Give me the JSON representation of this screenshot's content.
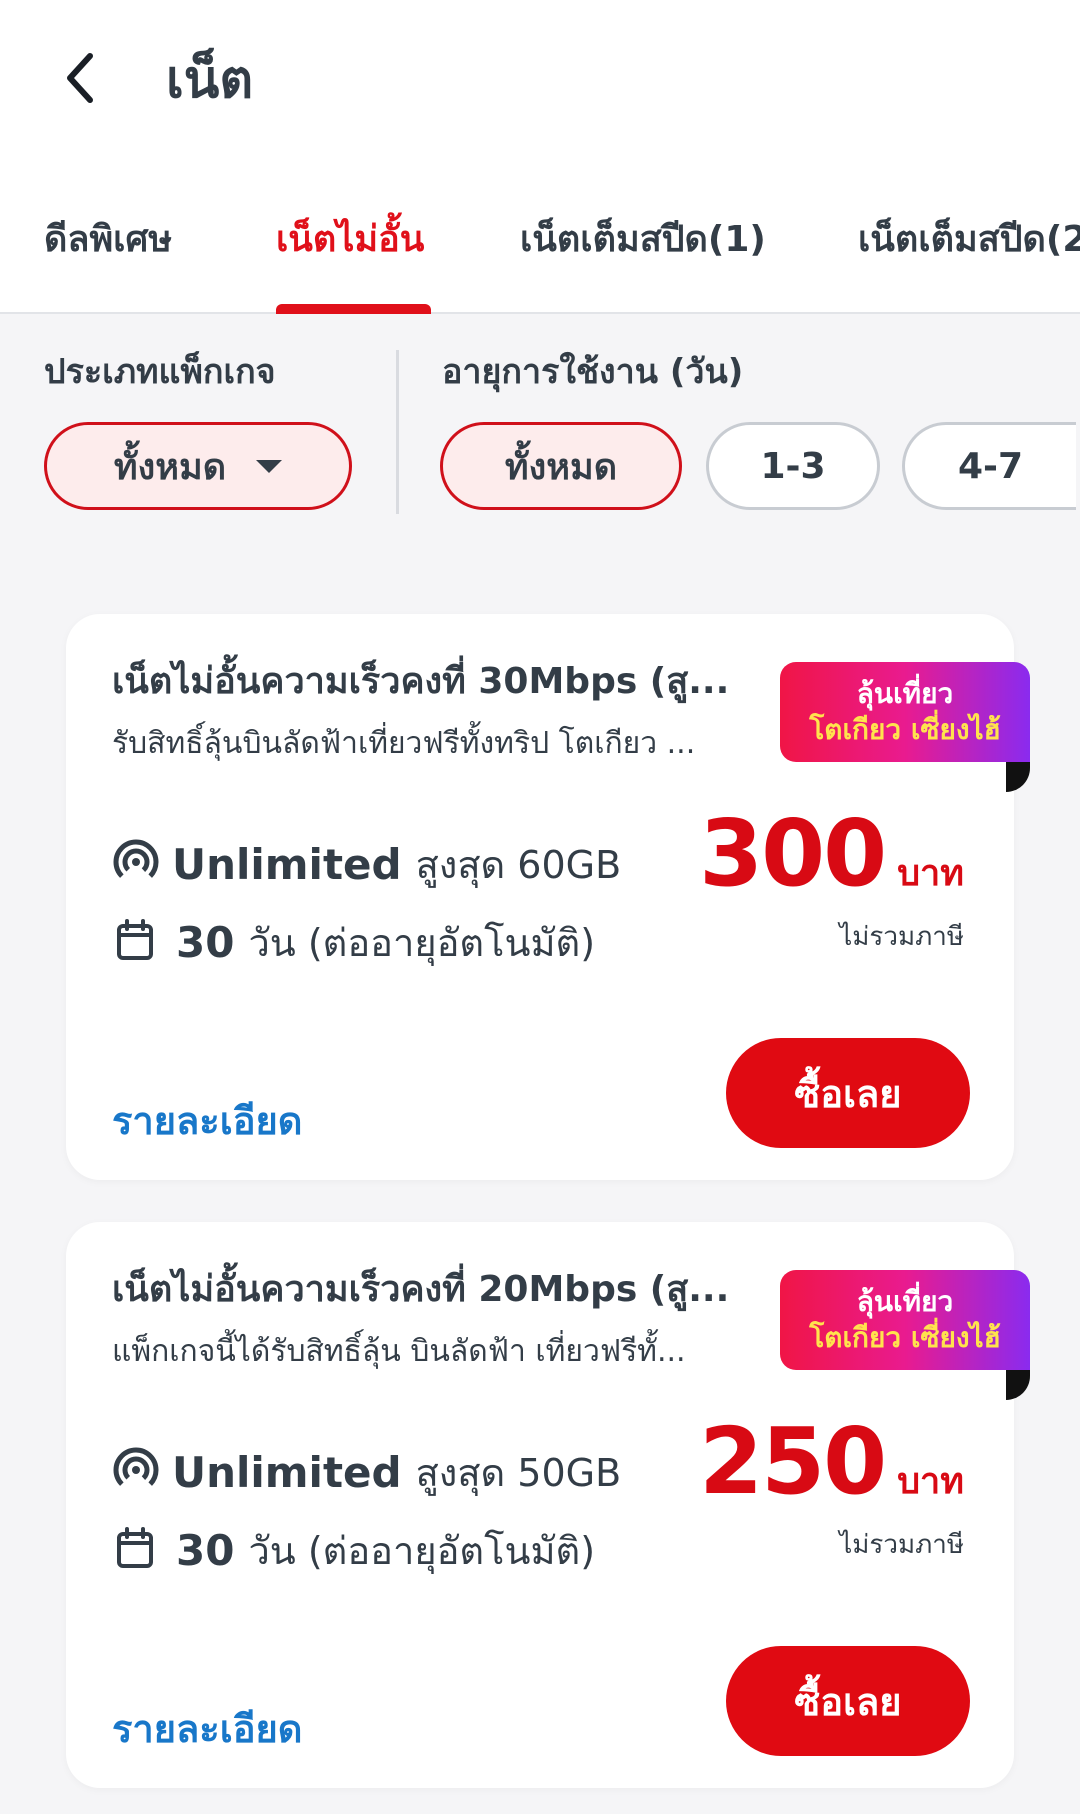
{
  "header": {
    "title": "เน็ต",
    "back_icon": "chevron-left-icon"
  },
  "tabs": [
    {
      "label": "ดีลพิเศษ",
      "active": false
    },
    {
      "label": "เน็ตไม่อั้น",
      "active": true
    },
    {
      "label": "เน็ตเต็มสปีด(1)",
      "active": false
    },
    {
      "label": "เน็ตเต็มสปีด(2",
      "active": false
    }
  ],
  "filters": {
    "package_type": {
      "label": "ประเภทแพ็กเกจ",
      "selected": "ทั้งหมด"
    },
    "duration": {
      "label": "อายุการใช้งาน (วัน)",
      "options": [
        {
          "label": "ทั้งหมด",
          "active": true
        },
        {
          "label": "1-3",
          "active": false
        },
        {
          "label": "4-7",
          "active": false
        }
      ]
    }
  },
  "colors": {
    "accent_red": "#e0101a",
    "link_blue": "#1877c9",
    "text_dark": "#333d47"
  },
  "packages": [
    {
      "title": "เน็ตไม่อั้นความเร็วคงที่ 30Mbps (สู...",
      "subtitle": "รับสิทธิ์ลุ้นบินลัดฟ้าเที่ยวฟรีทั้งทริป โตเกียว ...",
      "badge_line1": "ลุ้นเที่ยว",
      "badge_line2": "โตเกียว เซี่ยงไฮ้",
      "data_main": "Unlimited",
      "data_sub": "สูงสุด 60GB",
      "days_num": "30",
      "days_text": "วัน (ต่ออายุอัตโนมัติ)",
      "price": "300",
      "currency": "บาท",
      "vat_note": "ไม่รวมภาษี",
      "detail_label": "รายละเอียด",
      "buy_label": "ซื้อเลย"
    },
    {
      "title": "เน็ตไม่อั้นความเร็วคงที่ 20Mbps (สู...",
      "subtitle": "แพ็กเกจนี้ได้รับสิทธิ์ลุ้น บินลัดฟ้า เที่ยวฟรีทั้...",
      "badge_line1": "ลุ้นเที่ยว",
      "badge_line2": "โตเกียว เซี่ยงไฮ้",
      "data_main": "Unlimited",
      "data_sub": "สูงสุด 50GB",
      "days_num": "30",
      "days_text": "วัน (ต่ออายุอัตโนมัติ)",
      "price": "250",
      "currency": "บาท",
      "vat_note": "ไม่รวมภาษี",
      "detail_label": "รายละเอียด",
      "buy_label": "ซื้อเลย"
    }
  ]
}
